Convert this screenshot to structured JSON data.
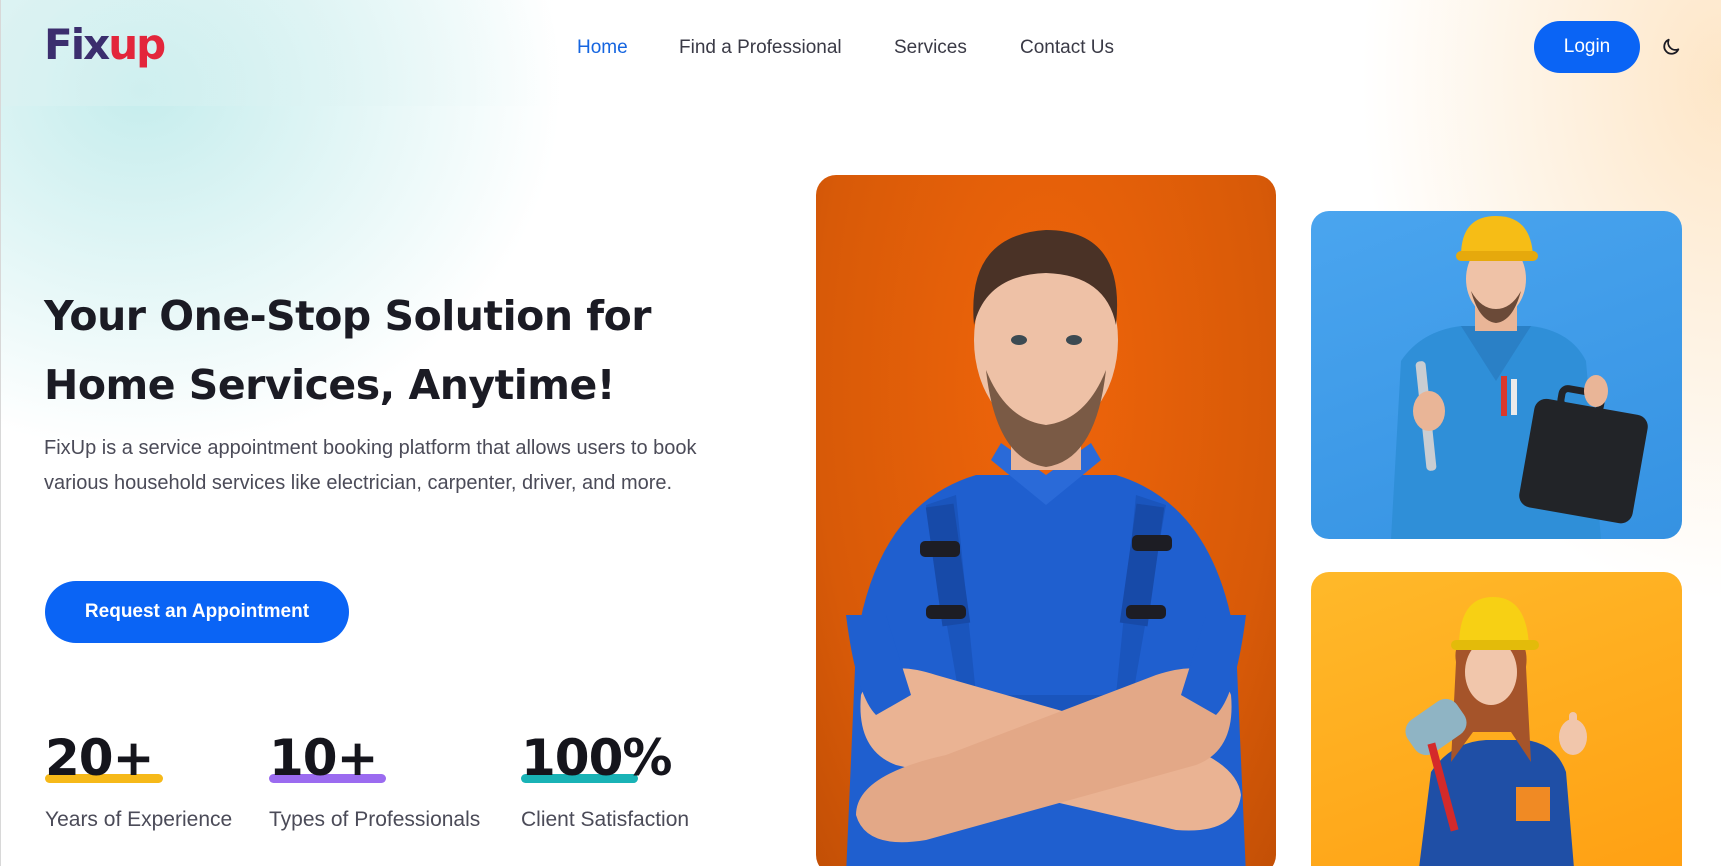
{
  "header": {
    "logo": {
      "part1": "Fix",
      "part2": "up"
    },
    "nav": [
      {
        "label": "Home",
        "active": true
      },
      {
        "label": "Find a Professional",
        "active": false
      },
      {
        "label": "Services",
        "active": false
      },
      {
        "label": "Contact Us",
        "active": false
      }
    ],
    "login_label": "Login",
    "theme_icon": "moon-icon"
  },
  "hero": {
    "title_line1": "Your One-Stop Solution for",
    "title_line2": "Home Services, Anytime!",
    "description": "FixUp is a service appointment booking platform that allows users to book various household services like electrician, carpenter, driver, and more.",
    "cta_label": "Request an Appointment"
  },
  "stats": [
    {
      "value": "20+",
      "label": "Years of Experience",
      "bar_color": "#f6b919"
    },
    {
      "value": "10+",
      "label": "Types of Professionals",
      "bar_color": "#9b6bf0"
    },
    {
      "value": "100%",
      "label": "Client Satisfaction",
      "bar_color": "#19b3b6"
    }
  ],
  "colors": {
    "primary": "#0a64f5",
    "nav_active": "#1565e0",
    "logo_dark": "#3b2e6e",
    "logo_red": "#e3263b"
  },
  "images": [
    {
      "name": "worker-crossed-arms-photo",
      "background": "#e2600a"
    },
    {
      "name": "worker-with-toolbox-photo",
      "background": "#3d9be8"
    },
    {
      "name": "worker-with-paint-roller-photo",
      "background": "#ffad1c"
    }
  ]
}
